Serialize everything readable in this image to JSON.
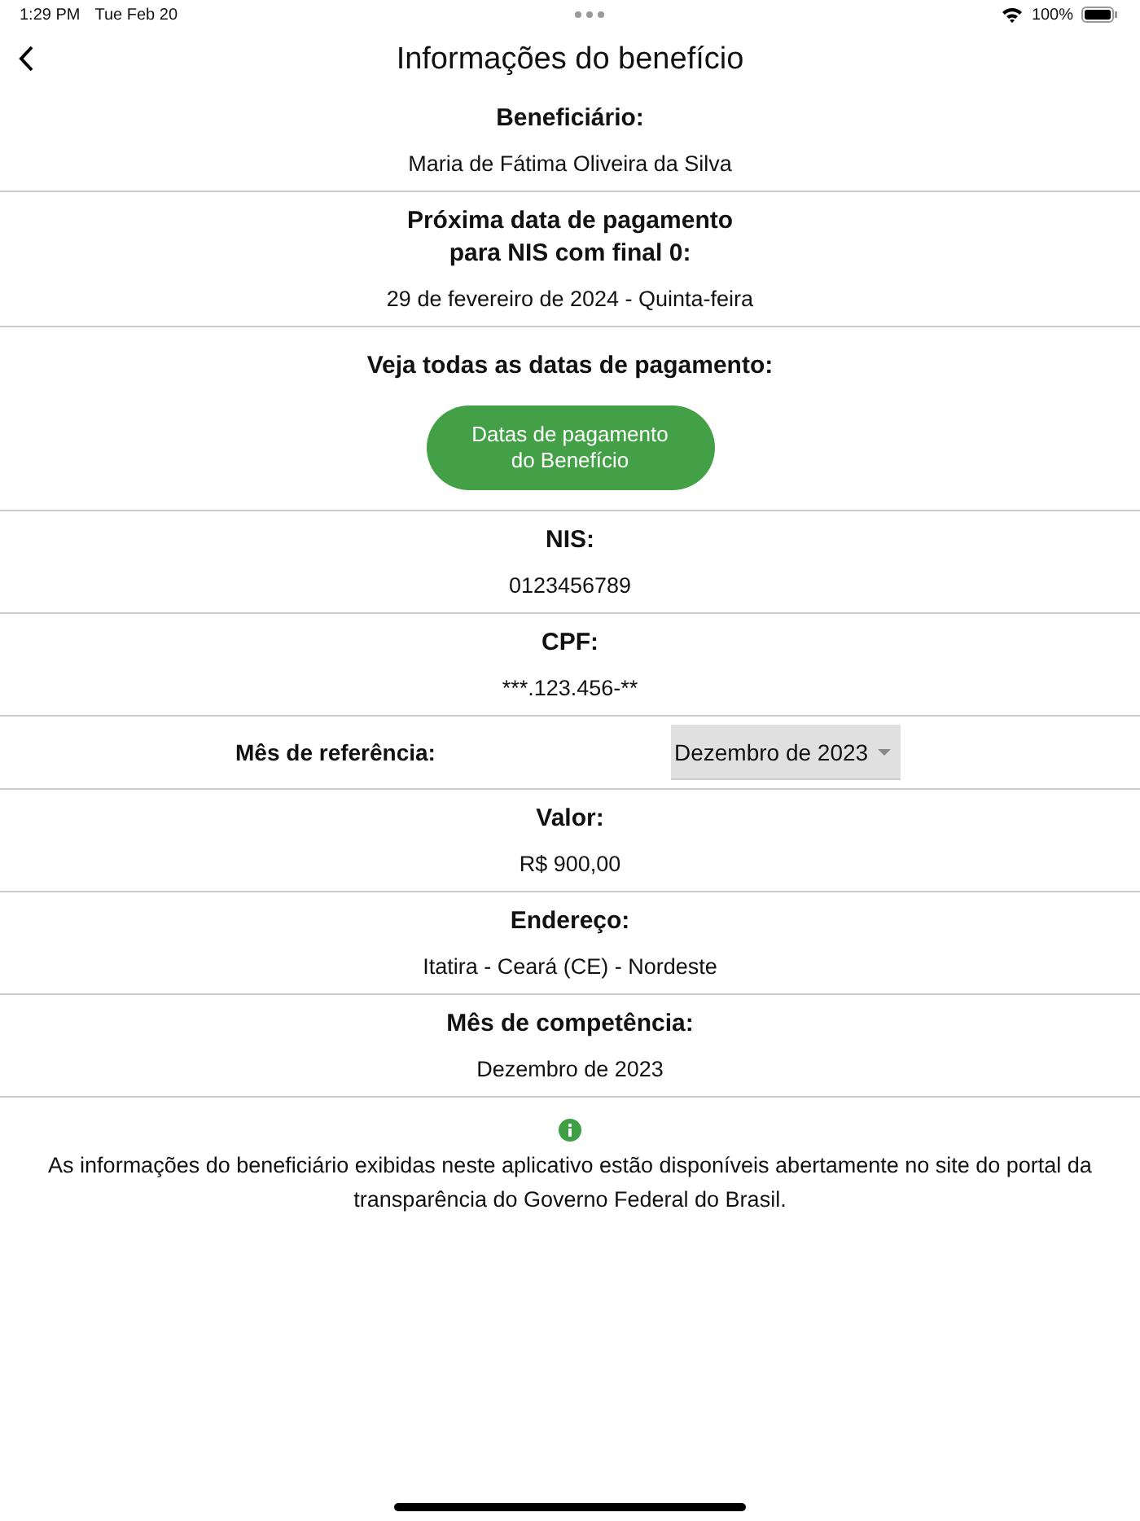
{
  "status_bar": {
    "time": "1:29 PM",
    "date": "Tue Feb 20",
    "battery": "100%"
  },
  "nav": {
    "title": "Informações do benefício"
  },
  "sections": [
    {
      "kind": "info",
      "label": "Beneficiário:",
      "value": "Maria de Fátima Oliveira da Silva"
    },
    {
      "kind": "info",
      "label": "Próxima data de pagamento\npara NIS com final 0:",
      "value": "29 de fevereiro de 2024 - Quinta-feira"
    },
    {
      "kind": "button",
      "label": "Veja todas as datas de pagamento:",
      "button": "Datas de pagamento\ndo Benefício"
    },
    {
      "kind": "info",
      "label": "NIS:",
      "value": "0123456789"
    },
    {
      "kind": "info",
      "label": "CPF:",
      "value": "***.123.456-**"
    },
    {
      "kind": "select",
      "label": "Mês de referência:",
      "value": "Dezembro de 2023"
    },
    {
      "kind": "info",
      "label": "Valor:",
      "value": "R$ 900,00"
    },
    {
      "kind": "info",
      "label": "Endereço:",
      "value": "Itatira - Ceará (CE) - Nordeste"
    },
    {
      "kind": "info",
      "label": "Mês de competência:",
      "value": "Dezembro de 2023"
    }
  ],
  "footer": {
    "note": "As informações do beneficiário exibidas neste aplicativo estão disponíveis abertamente no site do portal da transparência do Governo Federal do Brasil."
  }
}
